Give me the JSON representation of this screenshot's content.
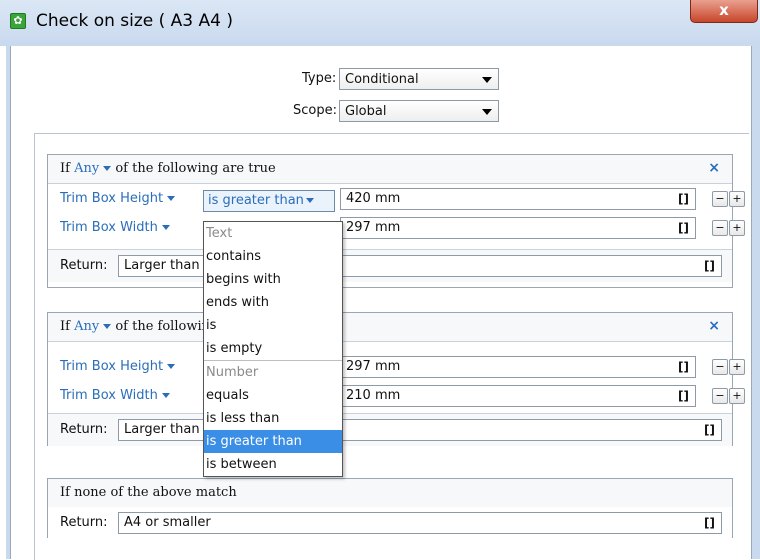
{
  "window": {
    "title": "Check on size ( A3 A4 )",
    "close_label": "x"
  },
  "form": {
    "type_label": "Type:",
    "type_value": "Conditional",
    "scope_label": "Scope:",
    "scope_value": "Global"
  },
  "groups": [
    {
      "prefix": "If",
      "quantifier": "Any",
      "suffix": "of the following are true",
      "rows": [
        {
          "field": "Trim Box Height",
          "operator": "is greater than",
          "value": "420 mm"
        },
        {
          "field": "Trim Box Width",
          "value": "297 mm"
        }
      ],
      "return_label": "Return:",
      "return_value": "Larger than"
    },
    {
      "prefix": "If",
      "quantifier": "Any",
      "suffix": "of the following are true",
      "rows": [
        {
          "field": "Trim Box Height",
          "value": "297 mm"
        },
        {
          "field": "Trim Box Width",
          "value": "210 mm"
        }
      ],
      "return_label": "Return:",
      "return_value": "Larger than"
    }
  ],
  "fallback": {
    "label": "If none of the above match",
    "return_label": "Return:",
    "return_value": "A4 or smaller"
  },
  "bracket_label": "[]",
  "row_buttons": {
    "minus": "−",
    "plus": "+"
  },
  "dropdown": {
    "text_header": "Text",
    "text_items": [
      "contains",
      "begins with",
      "ends with",
      "is",
      "is empty"
    ],
    "number_header": "Number",
    "number_items": [
      "equals",
      "is less than",
      "is greater than",
      "is between"
    ],
    "selected": "is greater than"
  },
  "colors": {
    "link_blue": "#2a6ebb",
    "selection": "#3a8ee6"
  }
}
